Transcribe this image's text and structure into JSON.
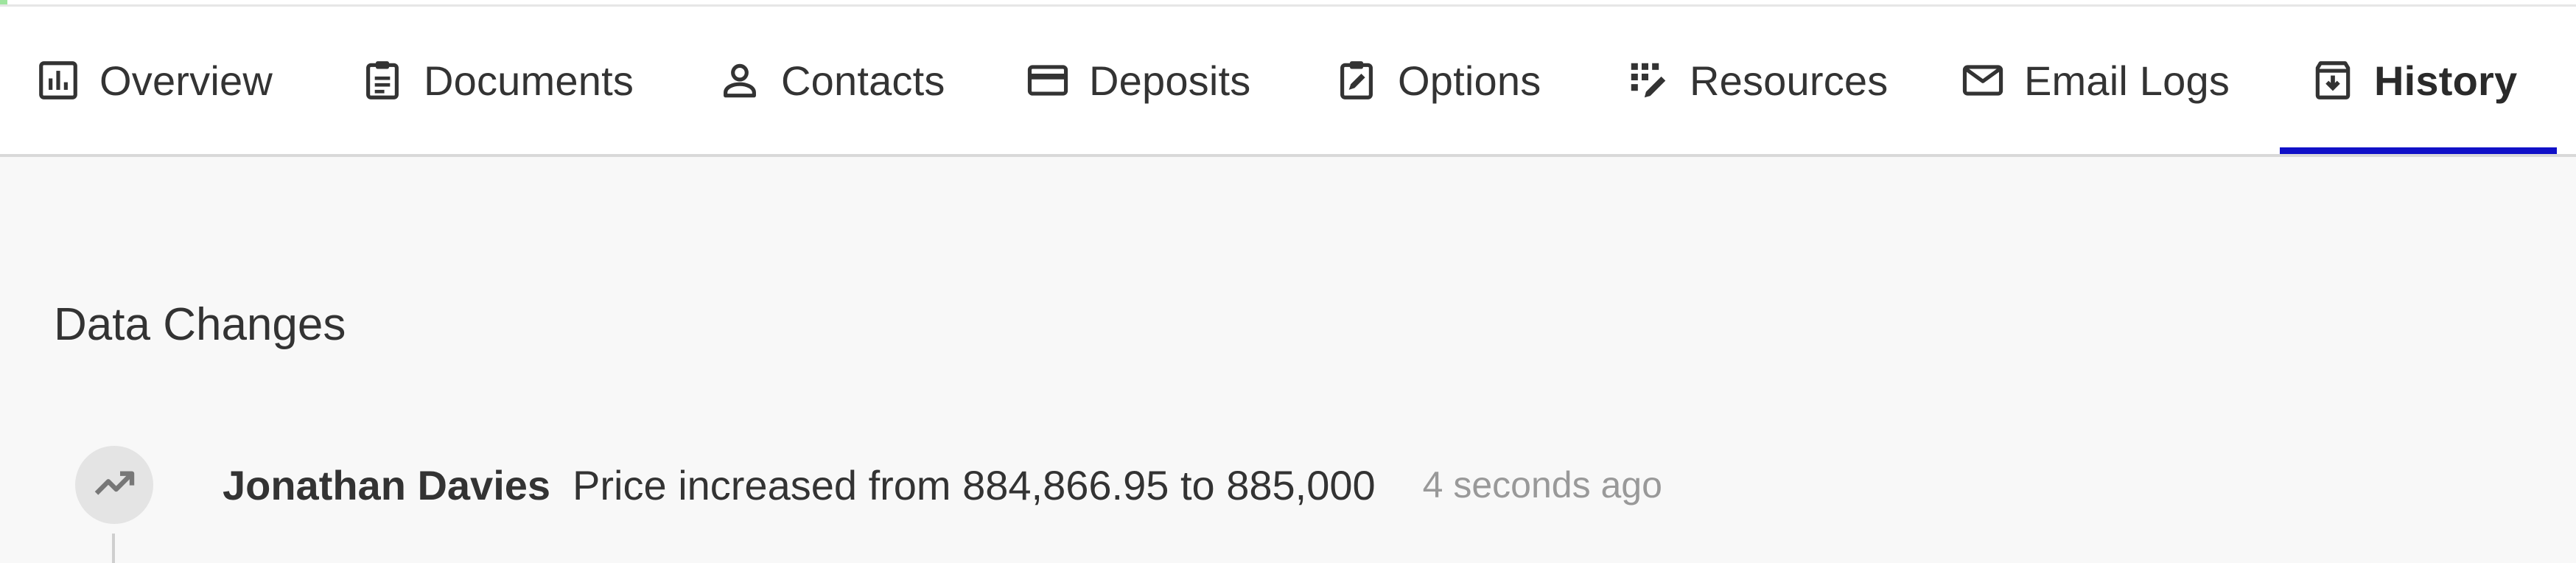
{
  "tabs": [
    {
      "label": "Overview",
      "icon": "bar-chart-icon"
    },
    {
      "label": "Documents",
      "icon": "clipboard-list-icon"
    },
    {
      "label": "Contacts",
      "icon": "person-icon"
    },
    {
      "label": "Deposits",
      "icon": "credit-card-icon"
    },
    {
      "label": "Options",
      "icon": "clipboard-edit-icon"
    },
    {
      "label": "Resources",
      "icon": "grid-edit-icon"
    },
    {
      "label": "Email Logs",
      "icon": "mail-icon"
    },
    {
      "label": "History",
      "icon": "archive-down-icon",
      "active": true
    }
  ],
  "section": {
    "title": "Data Changes"
  },
  "activity": {
    "icon": "trending-up-icon",
    "user": "Jonathan Davies",
    "message": "Price increased from 884,866.95 to 885,000",
    "time": "4 seconds ago"
  },
  "colors": {
    "active_underline": "#1010c8",
    "background": "#f8f8f8",
    "muted_text": "#999999"
  }
}
